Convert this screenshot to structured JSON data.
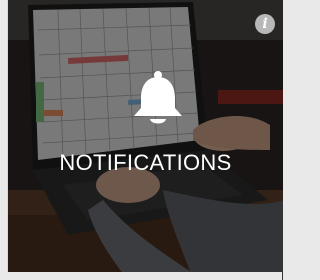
{
  "tile": {
    "title": "NOTIFICATIONS",
    "info_icon": "info-icon",
    "info_label": "i",
    "center_icon": "bell-icon",
    "background_image": "laptop-calendar-photo"
  },
  "colors": {
    "overlay": "#000000",
    "text": "#ffffff",
    "info_bg": "#b8b8b8"
  }
}
